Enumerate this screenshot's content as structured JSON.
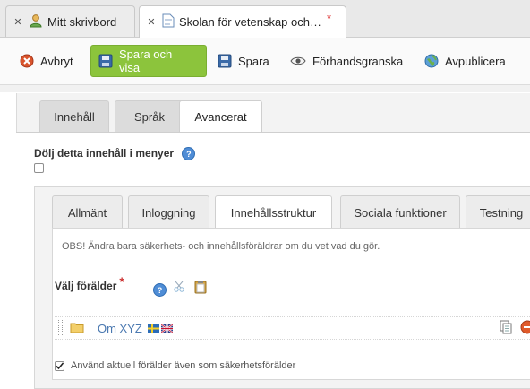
{
  "doc_tabs": [
    {
      "label": "Mitt skrivbord",
      "modified": ""
    },
    {
      "label": "Skolan för vetenskap och…",
      "modified": "*"
    }
  ],
  "toolbar": {
    "cancel": "Avbryt",
    "save_and_view": "Spara och visa",
    "save": "Spara",
    "preview": "Förhandsgranska",
    "unpublish": "Avpublicera"
  },
  "tabs": [
    "Innehåll",
    "Språk",
    "Avancerat"
  ],
  "hide_in_menus": {
    "label": "Dölj detta innehåll i menyer",
    "checked": false
  },
  "inner_tabs": [
    "Allmänt",
    "Inloggning",
    "Innehållsstruktur",
    "Sociala funktioner",
    "Testning"
  ],
  "note": "OBS! Ändra bara säkerhets- och innehållsföräldrar om du vet vad du gör.",
  "parent": {
    "label": "Välj förälder",
    "required_mark": "*",
    "item": "Om XYZ"
  },
  "use_as_security_parent": {
    "label": "Använd aktuell förälder även som säkerhetsförälder",
    "checked": true
  },
  "colors": {
    "primary_button": "#8cc43c",
    "link": "#4a78b0",
    "required": "#c33333"
  }
}
